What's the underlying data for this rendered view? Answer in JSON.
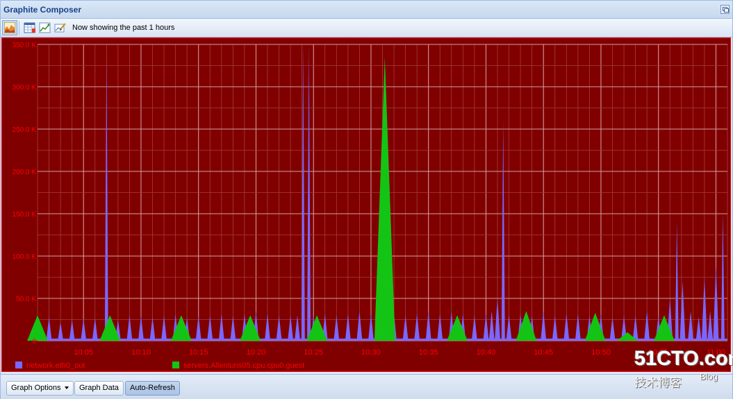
{
  "window": {
    "title": "Graphite Composer"
  },
  "toolbar": {
    "status": "Now showing the past 1 hours"
  },
  "buttons": {
    "graph_options": "Graph Options",
    "graph_data": "Graph Data",
    "auto_refresh": "Auto-Refresh"
  },
  "watermark": {
    "brand": "51CTO.com",
    "tagline": "技术博客",
    "blog": "Blog"
  },
  "colors": {
    "background": "#800000",
    "foreground": "#ff0000",
    "grid_major": "#d9a0a0",
    "grid_minor": "#a63c3c",
    "series_1": "#7a67ff",
    "series_2": "#14c414"
  },
  "chart_data": {
    "type": "area",
    "background": "#800000",
    "y_ticks": [
      "0",
      "50.0 K",
      "100.0 K",
      "150.0 K",
      "200.0 K",
      "250.0 K",
      "300.0 K",
      "350.0 K"
    ],
    "ylim": [
      0,
      350000
    ],
    "x_ticks": [
      "10:05",
      "10:10",
      "10:15",
      "10:20",
      "10:25",
      "10:30",
      "10:35",
      "10:40",
      "10:45",
      "10:50",
      "10:55",
      "11:00"
    ],
    "xlim_minutes": [
      1,
      61
    ],
    "legend_position": "bottom",
    "series": [
      {
        "name": "network.eth0_out",
        "color": "#7a67ff",
        "spikes": [
          [
            2,
            28000
          ],
          [
            3,
            22000
          ],
          [
            4,
            25000
          ],
          [
            5,
            26000
          ],
          [
            6,
            27000
          ],
          [
            7,
            340000
          ],
          [
            8,
            25000
          ],
          [
            9,
            30000
          ],
          [
            10,
            30000
          ],
          [
            11,
            28000
          ],
          [
            12,
            30000
          ],
          [
            13,
            32000
          ],
          [
            14,
            28000
          ],
          [
            15,
            30000
          ],
          [
            16,
            30000
          ],
          [
            17,
            32000
          ],
          [
            18,
            30000
          ],
          [
            19,
            32000
          ],
          [
            20,
            35000
          ],
          [
            21,
            32000
          ],
          [
            22,
            30000
          ],
          [
            23,
            30000
          ],
          [
            23.6,
            30000
          ],
          [
            24.1,
            350000
          ],
          [
            24.6,
            350000
          ],
          [
            25,
            30000
          ],
          [
            26,
            32000
          ],
          [
            27,
            30000
          ],
          [
            28,
            32000
          ],
          [
            29,
            35000
          ],
          [
            30,
            32000
          ],
          [
            31,
            35000
          ],
          [
            32,
            32000
          ],
          [
            33,
            30000
          ],
          [
            34,
            32000
          ],
          [
            35,
            35000
          ],
          [
            36,
            32000
          ],
          [
            37,
            35000
          ],
          [
            38,
            32000
          ],
          [
            39,
            30000
          ],
          [
            40,
            32000
          ],
          [
            40.5,
            35000
          ],
          [
            41,
            50000
          ],
          [
            41.5,
            260000
          ],
          [
            42,
            30000
          ],
          [
            43,
            32000
          ],
          [
            44,
            30000
          ],
          [
            45,
            35000
          ],
          [
            46,
            30000
          ],
          [
            47,
            32000
          ],
          [
            48,
            32000
          ],
          [
            49,
            30000
          ],
          [
            50,
            32000
          ],
          [
            51,
            28000
          ],
          [
            52,
            30000
          ],
          [
            53,
            30000
          ],
          [
            54,
            35000
          ],
          [
            55,
            30000
          ],
          [
            56,
            50000
          ],
          [
            56.6,
            140000
          ],
          [
            57.1,
            70000
          ],
          [
            57.8,
            35000
          ],
          [
            58.5,
            28000
          ],
          [
            59,
            75000
          ],
          [
            59.5,
            35000
          ],
          [
            60,
            90000
          ],
          [
            60.6,
            150000
          ]
        ]
      },
      {
        "name": "servers.Allentuns05.cpu.cpu0.guest",
        "color": "#14c414",
        "triangles": [
          [
            1,
            30000
          ],
          [
            7.3,
            30000
          ],
          [
            13.5,
            30000
          ],
          [
            19.5,
            30000
          ],
          [
            25.3,
            30000
          ],
          [
            31.2,
            335000
          ],
          [
            37.5,
            30000
          ],
          [
            43.5,
            35000
          ],
          [
            49.5,
            33000
          ],
          [
            52.3,
            10000
          ],
          [
            55.5,
            30000
          ]
        ]
      }
    ]
  }
}
